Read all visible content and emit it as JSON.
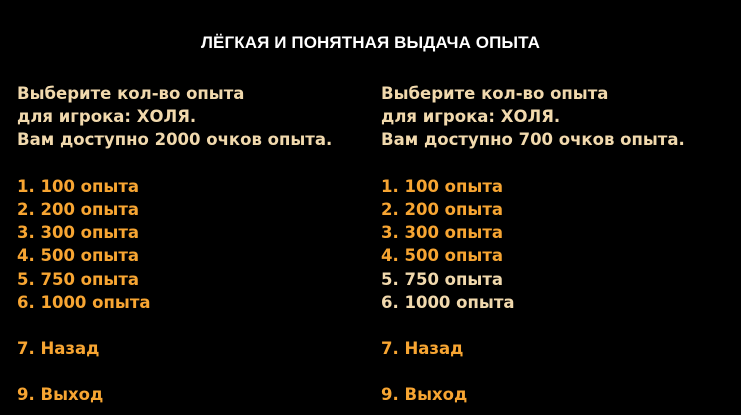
{
  "title": "ЛЁГКАЯ И ПОНЯТНАЯ ВЫДАЧА ОПЫТА",
  "colors": {
    "background": "#000000",
    "title": "#ffffff",
    "info_text": "#f1d9ad",
    "available_option": "#f7a532",
    "unavailable_option": "#f1d9ad"
  },
  "menus": [
    {
      "header": [
        "Выберите кол-во опыта",
        "для игрока: ХОЛЯ.",
        "Вам доступно 2000 очков опыта."
      ],
      "options": [
        {
          "label": "1. 100 опыта",
          "available": true
        },
        {
          "label": "2. 200 опыта",
          "available": true
        },
        {
          "label": "3. 300 опыта",
          "available": true
        },
        {
          "label": "4. 500 опыта",
          "available": true
        },
        {
          "label": "5. 750 опыта",
          "available": true
        },
        {
          "label": "6. 1000 опыта",
          "available": true
        }
      ],
      "back": "7. Назад",
      "exit": "9. Выход"
    },
    {
      "header": [
        "Выберите кол-во опыта",
        "для игрока: ХОЛЯ.",
        "Вам доступно 700 очков опыта."
      ],
      "options": [
        {
          "label": "1. 100 опыта",
          "available": true
        },
        {
          "label": "2. 200 опыта",
          "available": true
        },
        {
          "label": "3. 300 опыта",
          "available": true
        },
        {
          "label": "4. 500 опыта",
          "available": true
        },
        {
          "label": "5. 750 опыта",
          "available": false
        },
        {
          "label": "6. 1000 опыта",
          "available": false
        }
      ],
      "back": "7. Назад",
      "exit": "9. Выход"
    }
  ]
}
